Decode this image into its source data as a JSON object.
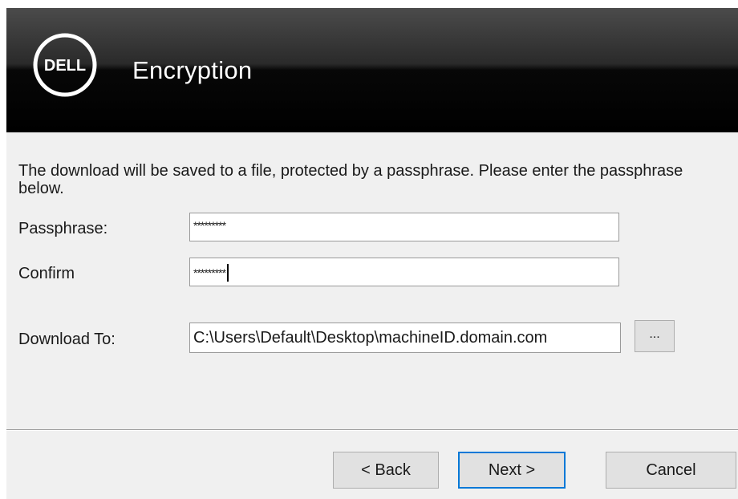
{
  "header": {
    "logo_text": "DELL",
    "title": "Encryption"
  },
  "instructions": "The download will be saved to a file, protected by a passphrase.  Please enter the passphrase below.",
  "form": {
    "passphrase_label": "Passphrase:",
    "passphrase_value": "*********",
    "confirm_label": "Confirm",
    "confirm_value": "*********",
    "download_label": "Download To:",
    "download_path": "C:\\Users\\Default\\Desktop\\machineID.domain.com",
    "browse_label": "..."
  },
  "buttons": {
    "back": "< Back",
    "next": "Next >",
    "cancel": "Cancel"
  },
  "colors": {
    "banner": "#000000",
    "window": "#f0f0f0",
    "focus_border": "#0078d7"
  }
}
